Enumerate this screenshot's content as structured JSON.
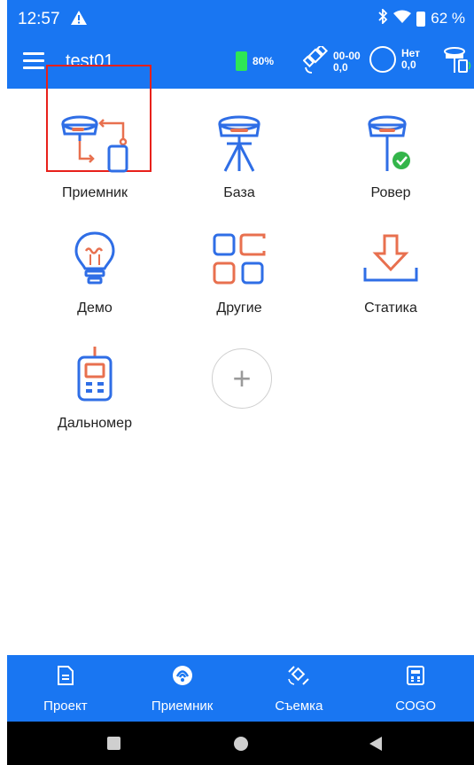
{
  "status_bar": {
    "time": "12:57",
    "battery_percent": "62 %"
  },
  "app_bar": {
    "title": "test01",
    "gnss_battery": "80%",
    "sat_line1": "00-00",
    "sat_line2": "0,0",
    "link_line1": "Нет",
    "link_line2": "0,0"
  },
  "tiles": [
    {
      "label": "Приемник",
      "icon": "receiver-connect-icon"
    },
    {
      "label": "База",
      "icon": "base-tripod-icon"
    },
    {
      "label": "Ровер",
      "icon": "rover-icon"
    },
    {
      "label": "Демо",
      "icon": "lightbulb-icon"
    },
    {
      "label": "Другие",
      "icon": "grid-apps-icon"
    },
    {
      "label": "Статика",
      "icon": "download-tray-icon"
    },
    {
      "label": "Дальномер",
      "icon": "rangefinder-icon"
    }
  ],
  "add_symbol": "+",
  "bottom_nav": [
    {
      "label": "Проект",
      "icon": "document-icon"
    },
    {
      "label": "Приемник",
      "icon": "receiver-icon"
    },
    {
      "label": "Съемка",
      "icon": "survey-icon"
    },
    {
      "label": "COGO",
      "icon": "calculator-icon"
    }
  ],
  "colors": {
    "primary": "#1976f2",
    "accent_orange": "#e8704f",
    "icon_blue": "#2f6ee6",
    "highlight_red": "#e8201a",
    "success_green": "#33b54a"
  }
}
